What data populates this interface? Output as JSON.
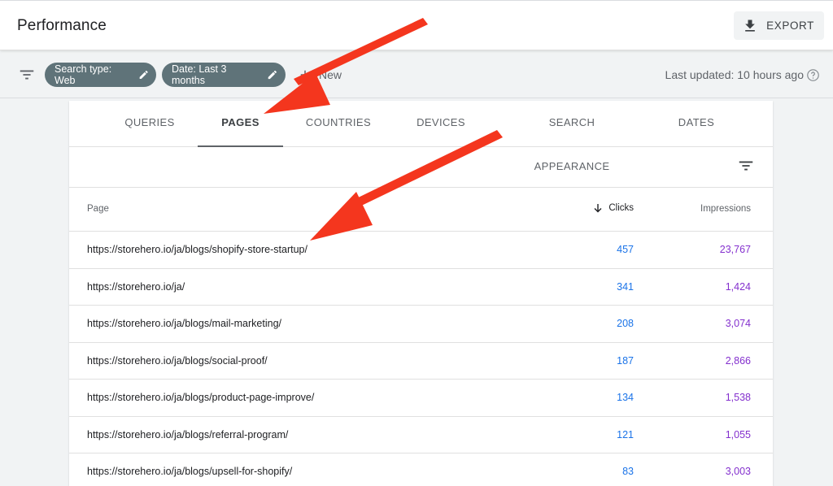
{
  "header": {
    "title": "Performance",
    "export_label": "EXPORT"
  },
  "filters": {
    "chips": [
      {
        "label": "Search type: Web"
      },
      {
        "label": "Date: Last 3 months"
      }
    ],
    "new_label": "New",
    "last_updated": "Last updated: 10 hours ago"
  },
  "tabs": [
    {
      "label": "QUERIES",
      "active": false
    },
    {
      "label": "PAGES",
      "active": true
    },
    {
      "label": "COUNTRIES",
      "active": false
    },
    {
      "label": "DEVICES",
      "active": false
    },
    {
      "label": "SEARCH APPEARANCE",
      "active": false
    },
    {
      "label": "DATES",
      "active": false
    }
  ],
  "table": {
    "columns": {
      "page": "Page",
      "clicks": "Clicks",
      "impressions": "Impressions"
    },
    "sort_column": "clicks",
    "sort_direction": "descending",
    "rows": [
      {
        "page": "https://storehero.io/ja/blogs/shopify-store-startup/",
        "clicks": "457",
        "impressions": "23,767"
      },
      {
        "page": "https://storehero.io/ja/",
        "clicks": "341",
        "impressions": "1,424"
      },
      {
        "page": "https://storehero.io/ja/blogs/mail-marketing/",
        "clicks": "208",
        "impressions": "3,074"
      },
      {
        "page": "https://storehero.io/ja/blogs/social-proof/",
        "clicks": "187",
        "impressions": "2,866"
      },
      {
        "page": "https://storehero.io/ja/blogs/product-page-improve/",
        "clicks": "134",
        "impressions": "1,538"
      },
      {
        "page": "https://storehero.io/ja/blogs/referral-program/",
        "clicks": "121",
        "impressions": "1,055"
      },
      {
        "page": "https://storehero.io/ja/blogs/upsell-for-shopify/",
        "clicks": "83",
        "impressions": "3,003"
      }
    ]
  },
  "colors": {
    "clicks": "#1a73e8",
    "impressions": "#8430ce",
    "chip_bg": "#5f7379",
    "annotation_arrow": "#f4361e"
  },
  "icons": [
    "download-icon",
    "filter-icon",
    "pencil-icon",
    "plus-icon",
    "help-icon",
    "arrow-down-icon"
  ]
}
